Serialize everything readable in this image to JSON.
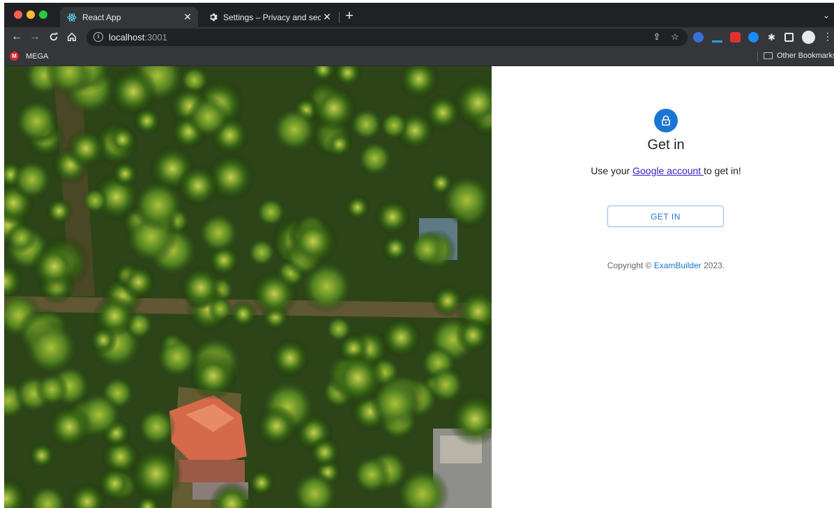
{
  "browser": {
    "tabs": [
      {
        "title": "React App",
        "icon": "react-icon",
        "active": true
      },
      {
        "title": "Settings – Privacy and security",
        "icon": "gear-icon",
        "active": false
      }
    ],
    "new_tab_label": "+",
    "url_host": "localhost",
    "url_port": ":3001",
    "bookmarks": [
      {
        "label": "MEGA",
        "icon": "mega-icon"
      }
    ],
    "other_bookmarks_label": "Other Bookmarks"
  },
  "signin": {
    "icon": "lock-icon",
    "accent_color": "#1976d2",
    "heading": "Get in",
    "subtext_prefix": "Use your ",
    "subtext_link": "Google account ",
    "subtext_suffix": "to get in!",
    "button_label": "GET IN",
    "copyright_prefix": "Copyright © ",
    "copyright_link": "ExamBuilder",
    "copyright_suffix": " 2023."
  },
  "hero_image": {
    "description_icon": "aerial-palm-forest-image"
  }
}
